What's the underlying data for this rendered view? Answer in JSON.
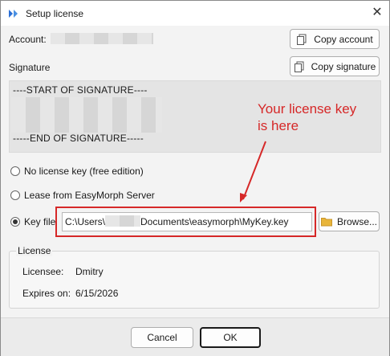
{
  "window": {
    "title": "Setup license",
    "app_icon": "easymorph-logo-icon",
    "close_icon": "close-icon",
    "close_symbol": "✕"
  },
  "account": {
    "label": "Account:",
    "copy_button": "Copy account"
  },
  "signature": {
    "label": "Signature",
    "copy_button": "Copy signature",
    "start_line": "----START OF SIGNATURE----",
    "end_line": "-----END OF SIGNATURE-----"
  },
  "annotation": {
    "line1": "Your license key",
    "line2": "is here",
    "color": "#d62828"
  },
  "options": {
    "no_license": "No license key (free edition)",
    "lease": "Lease from EasyMorph Server",
    "key_file": "Key file",
    "selected": "key_file"
  },
  "key_file": {
    "path_prefix": "C:\\Users\\",
    "path_suffix": "Documents\\easymorph\\MyKey.key",
    "browse_button": "Browse..."
  },
  "license": {
    "group_title": "License",
    "licensee_label": "Licensee:",
    "licensee_value": "Dmitry",
    "expires_label": "Expires on:",
    "expires_value": "6/15/2026"
  },
  "footer": {
    "cancel": "Cancel",
    "ok": "OK"
  }
}
